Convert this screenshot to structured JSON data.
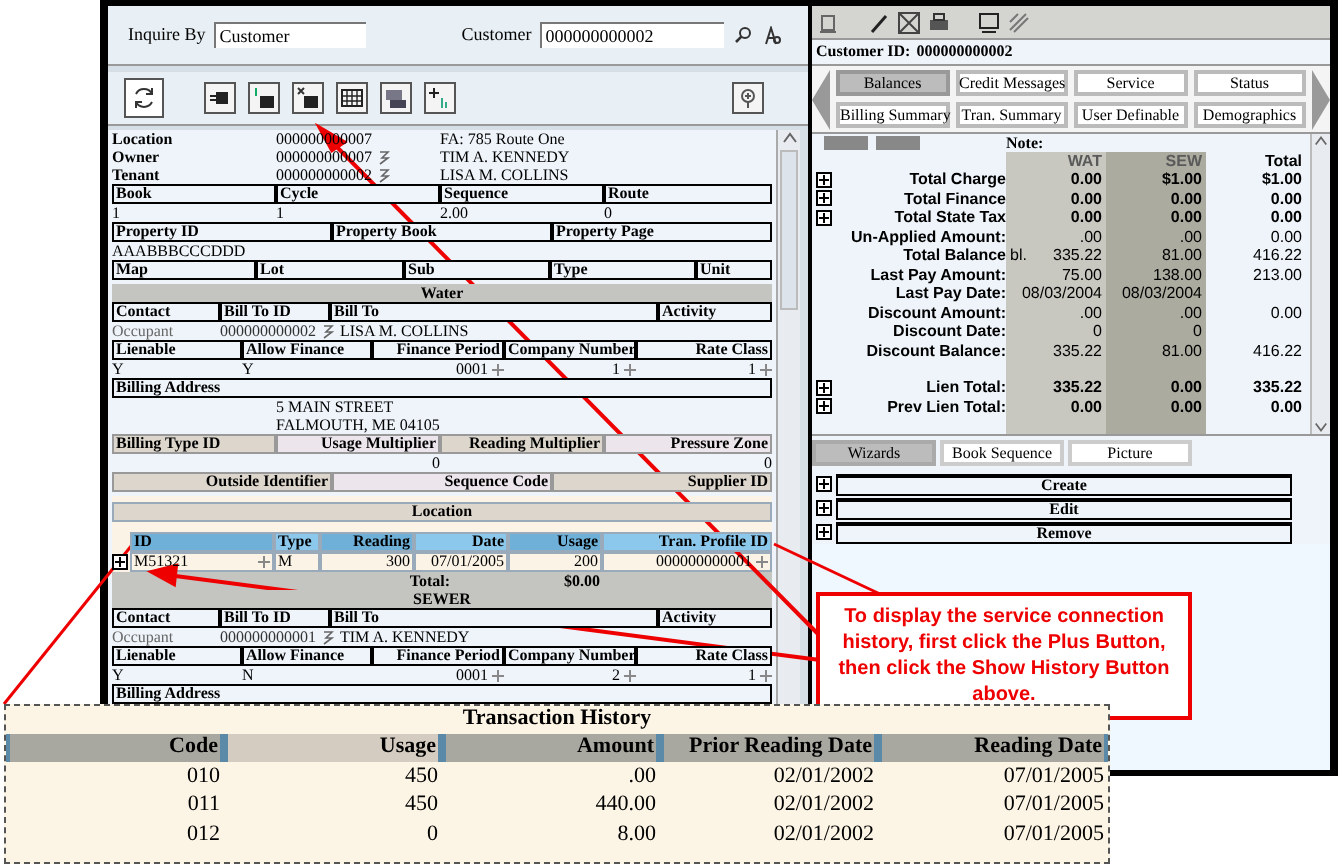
{
  "inquire": {
    "label": "Inquire By",
    "value": "Customer",
    "customer_label": "Customer",
    "customer_value": "000000000002"
  },
  "location_info": [
    {
      "label": "Location",
      "id": "000000000007",
      "detail": "FA: 785 Route One",
      "link": false
    },
    {
      "label": "Owner",
      "id": "000000000007",
      "detail": "TIM A. KENNEDY",
      "link": true
    },
    {
      "label": "Tenant",
      "id": "000000000002",
      "detail": "LISA M. COLLINS",
      "link": true
    }
  ],
  "book": {
    "headers": [
      "Book",
      "Cycle",
      "Sequence",
      "Route"
    ],
    "values": [
      "1",
      "1",
      "2.00",
      "0"
    ]
  },
  "property": {
    "headers": [
      "Property ID",
      "Property Book",
      "Property Page"
    ],
    "value": "AAABBBCCCDDD"
  },
  "map_headers": [
    "Map",
    "Lot",
    "Sub",
    "Type",
    "Unit"
  ],
  "water": {
    "title": "Water",
    "contact_headers": [
      "Contact",
      "Bill To ID",
      "Bill To",
      "Activity"
    ],
    "occupant": {
      "contact": "Occupant",
      "bill_to_id": "000000000002",
      "bill_to": "LISA M. COLLINS"
    },
    "finance_headers": [
      "Lienable",
      "Allow Finance",
      "Finance Period",
      "Company Number",
      "Rate Class"
    ],
    "finance_values": [
      {
        "text": "Y",
        "spinner": false
      },
      {
        "text": "Y",
        "spinner": false
      },
      {
        "text": "0001",
        "spinner": true
      },
      {
        "text": "1",
        "spinner": true
      },
      {
        "text": "1",
        "spinner": true
      }
    ],
    "address_header": "Billing Address",
    "address_lines": [
      "5 MAIN STREET",
      "FALMOUTH, ME 04105"
    ],
    "billing_headers": [
      "Billing Type ID",
      "Usage Multiplier",
      "Reading Multiplier",
      "Pressure Zone"
    ],
    "usage_multiplier": "0",
    "pressure_zone": "0",
    "outside_headers": [
      "Outside Identifier",
      "Sequence Code",
      "Supplier ID"
    ],
    "location_title": "Location",
    "meter_columns": [
      "ID",
      "Type",
      "Reading",
      "Date",
      "Usage",
      "Tran. Profile ID"
    ],
    "meter_rows": [
      {
        "cells": [
          "M51321",
          "M",
          "300",
          "07/01/2005",
          "200",
          "000000000001"
        ]
      }
    ],
    "total_label": "Total:",
    "total_value": "$0.00"
  },
  "sewer": {
    "title": "SEWER",
    "contact_headers": [
      "Contact",
      "Bill To ID",
      "Bill To",
      "Activity"
    ],
    "occupant": {
      "contact": "Occupant",
      "bill_to_id": "000000000001",
      "bill_to": "TIM A. KENNEDY"
    },
    "finance_headers": [
      "Lienable",
      "Allow Finance",
      "Finance Period",
      "Company Number",
      "Rate Class"
    ],
    "finance_values": [
      {
        "text": "Y",
        "spinner": false
      },
      {
        "text": "N",
        "spinner": false
      },
      {
        "text": "0001",
        "spinner": true
      },
      {
        "text": "2",
        "spinner": true
      },
      {
        "text": "1",
        "spinner": true
      }
    ],
    "address_header": "Billing Address"
  },
  "customer_id": {
    "label": "Customer ID:",
    "value": "000000000002"
  },
  "tabs": [
    [
      {
        "label": "Balances",
        "selected": true
      },
      {
        "label": "Credit Messages",
        "selected": false
      },
      {
        "label": "Service",
        "selected": false
      },
      {
        "label": "Status",
        "selected": false
      }
    ],
    [
      {
        "label": "Billing Summary",
        "selected": false
      },
      {
        "label": "Tran. Summary",
        "selected": false
      },
      {
        "label": "User Definable",
        "selected": false
      },
      {
        "label": "Demographics",
        "selected": false
      }
    ]
  ],
  "note_label": "Note:",
  "balance_columns": [
    "WAT",
    "SEW",
    "Total"
  ],
  "balance_rows": [
    {
      "label": "Total Charge",
      "kind": "expandable",
      "values": [
        "0.00",
        "$1.00",
        "$1.00"
      ]
    },
    {
      "label": "Total Finance",
      "kind": "expandable",
      "values": [
        "0.00",
        "0.00",
        "0.00"
      ]
    },
    {
      "label": "Total State Tax",
      "kind": "expandable",
      "values": [
        "0.00",
        "0.00",
        "0.00"
      ]
    },
    {
      "label": "Un-Applied Amount:",
      "kind": "plain",
      "values": [
        ".00",
        ".00",
        "0.00"
      ]
    },
    {
      "label": "Total Balance",
      "kind": "plain",
      "prefix": "bl.",
      "values": [
        "335.22",
        "81.00",
        "416.22"
      ]
    },
    {
      "label": "Last Pay Amount:",
      "kind": "plain",
      "values": [
        "75.00",
        "138.00",
        "213.00"
      ]
    },
    {
      "label": "Last Pay Date:",
      "kind": "plain",
      "values": [
        "08/03/2004",
        "08/03/2004"
      ]
    },
    {
      "label": "Discount Amount:",
      "kind": "plain",
      "values": [
        ".00",
        ".00",
        "0.00"
      ]
    },
    {
      "label": "Discount Date:",
      "kind": "plain",
      "values": [
        "0",
        "0"
      ]
    },
    {
      "label": "Discount Balance:",
      "kind": "plain",
      "values": [
        "335.22",
        "81.00",
        "416.22"
      ]
    }
  ],
  "lien_rows": [
    {
      "label": "Lien Total:",
      "kind": "expandable",
      "values": [
        "335.22",
        "0.00",
        "335.22"
      ]
    },
    {
      "label": "Prev Lien Total:",
      "kind": "expandable",
      "values": [
        "0.00",
        "0.00",
        "0.00"
      ]
    }
  ],
  "bottom_tabs": [
    {
      "label": "Wizards",
      "selected": true
    },
    {
      "label": "Book Sequence",
      "selected": false
    },
    {
      "label": "Picture",
      "selected": false
    }
  ],
  "wizards": [
    "Create",
    "Edit",
    "Remove"
  ],
  "callout": "To display the service connection history, first click the Plus Button, then click the Show History Button above.",
  "history": {
    "title": "Transaction History",
    "columns": [
      "Code",
      "Usage",
      "Amount",
      "Prior Reading Date",
      "Reading Date"
    ],
    "rows": [
      [
        "010",
        "450",
        ".00",
        "02/01/2002",
        "07/01/2005"
      ],
      [
        "011",
        "450",
        "440.00",
        "02/01/2002",
        "07/01/2005"
      ],
      [
        "012",
        "0",
        "8.00",
        "02/01/2002",
        "07/01/2005"
      ]
    ]
  }
}
